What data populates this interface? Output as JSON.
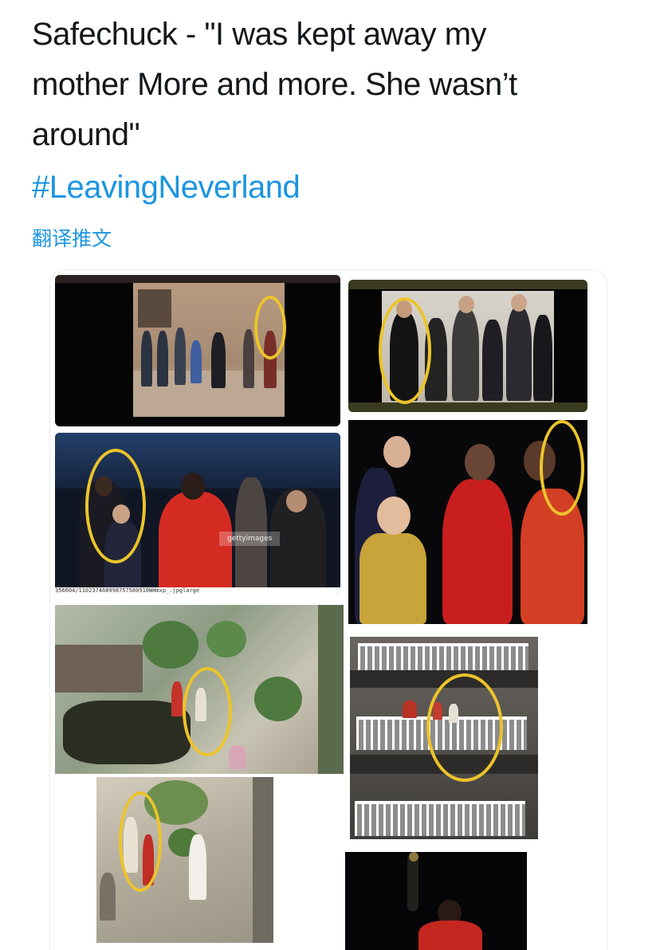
{
  "tweet": {
    "text": "Safechuck - \"I was kept away my\nmother More and more. She wasn’t\naround\"",
    "hashtag": "#LeavingNeverland",
    "translate_label": "翻译推文"
  },
  "collage": {
    "photo_caption": "356604/110237468998757580910WHmxp_.jpglarge",
    "watermark": "gettyimages",
    "highlight_color": "#ecc42a"
  }
}
